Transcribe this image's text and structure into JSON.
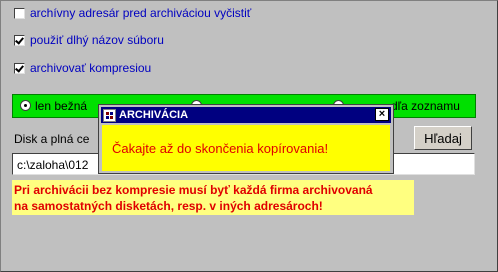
{
  "options": [
    {
      "label": "archívny adresár pred archiváciou vyčistiť",
      "checked": false
    },
    {
      "label": "použiť dlhý názov súboru",
      "checked": true
    },
    {
      "label": "archivovať kompresiou",
      "checked": true
    }
  ],
  "radios": {
    "left_label": "len bežná",
    "right_label": "dľa zoznamu"
  },
  "disk": {
    "label": "Disk a plná ce",
    "value": "c:\\zaloha\\012"
  },
  "search_button": "Hľadaj",
  "warning": {
    "line1": "Pri archivácii bez kompresie musí byť každá firma archivovaná",
    "line2": "na samostatných disketách, resp. v iných adresároch!"
  },
  "dialog": {
    "title": "ARCHIVÁCIA",
    "message": "Čakajte až do skončenia kopírovania!",
    "close": "×"
  }
}
